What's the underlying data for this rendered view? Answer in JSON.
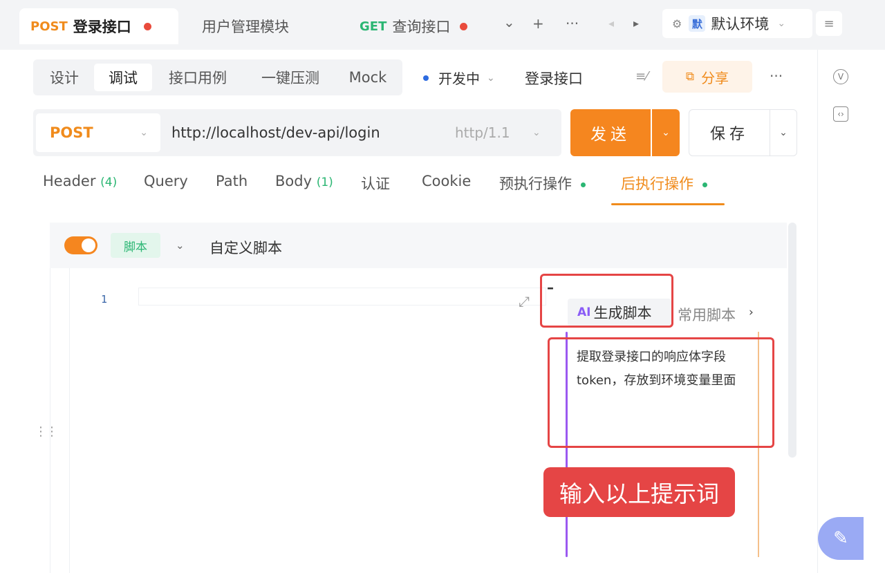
{
  "tabs": [
    {
      "method": "POST",
      "label": "登录接口"
    },
    {
      "method": "",
      "label": "用户管理模块"
    },
    {
      "method": "GET",
      "label": "查询接口"
    }
  ],
  "environment": {
    "badge": "默",
    "label": "默认环境"
  },
  "icons": {
    "chevron": "⌄",
    "plus": "+",
    "more": "···",
    "prev": "◂",
    "next": "▸",
    "hamburger": "≡"
  },
  "subnav": {
    "items": [
      "设计",
      "调试",
      "接口用例",
      "一键压测",
      "Mock"
    ],
    "active_index": 1
  },
  "status": {
    "label": "开发中"
  },
  "api_name": "登录接口",
  "share_label": "分享",
  "request": {
    "method": "POST",
    "url": "http://localhost/dev-api/login",
    "protocol": "http/1.1",
    "send_label": "发送",
    "save_label": "保存"
  },
  "request_tabs": [
    {
      "label": "Header",
      "count": "(4)"
    },
    {
      "label": "Query",
      "count": ""
    },
    {
      "label": "Path",
      "count": ""
    },
    {
      "label": "Body",
      "count": "(1)"
    },
    {
      "label": "认证",
      "count": ""
    },
    {
      "label": "Cookie",
      "count": ""
    },
    {
      "label": "预执行操作",
      "count": ""
    },
    {
      "label": "后执行操作",
      "count": ""
    }
  ],
  "script": {
    "enabled": true,
    "tag": "脚本",
    "name": "自定义脚本",
    "line_number": "1"
  },
  "ai": {
    "minimize": "–",
    "ai_mark": "AI",
    "generate_tab": "生成脚本",
    "common_tab": "常用脚本",
    "prompt": "提取登录接口的响应体字段token，存放到环境变量里面"
  },
  "annotation": {
    "callout": "输入以上提示词"
  },
  "colors": {
    "accent": "#f5861f",
    "post": "#f08b1c",
    "get": "#2bb673",
    "annotation_red": "#e54545",
    "ai_purple": "#8a5cf6"
  }
}
